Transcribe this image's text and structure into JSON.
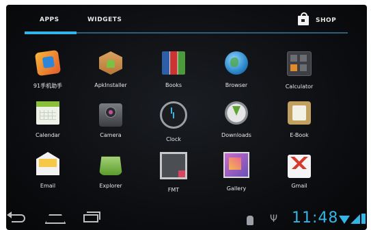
{
  "tabs": {
    "apps": "APPS",
    "widgets": "WIDGETS",
    "shop": "SHOP"
  },
  "apps": [
    {
      "label": "91手机助手",
      "icon": "91-assistant-icon"
    },
    {
      "label": "ApkInstaller",
      "icon": "apk-installer-icon"
    },
    {
      "label": "Books",
      "icon": "books-icon"
    },
    {
      "label": "Browser",
      "icon": "browser-globe-icon"
    },
    {
      "label": "Calculator",
      "icon": "calculator-icon"
    },
    {
      "label": "Calendar",
      "icon": "calendar-icon"
    },
    {
      "label": "Camera",
      "icon": "camera-icon"
    },
    {
      "label": "Clock",
      "icon": "clock-icon"
    },
    {
      "label": "Downloads",
      "icon": "download-icon"
    },
    {
      "label": "E-Book",
      "icon": "ebook-icon"
    },
    {
      "label": "Email",
      "icon": "email-icon"
    },
    {
      "label": "Explorer",
      "icon": "explorer-icon"
    },
    {
      "label": "FMT",
      "icon": "fmt-icon"
    },
    {
      "label": "Gallery",
      "icon": "gallery-icon"
    },
    {
      "label": "Gmail",
      "icon": "gmail-icon"
    }
  ],
  "status": {
    "time": "11:48"
  },
  "colors": {
    "accent": "#33b5e5",
    "background": "#0b0c0f"
  }
}
